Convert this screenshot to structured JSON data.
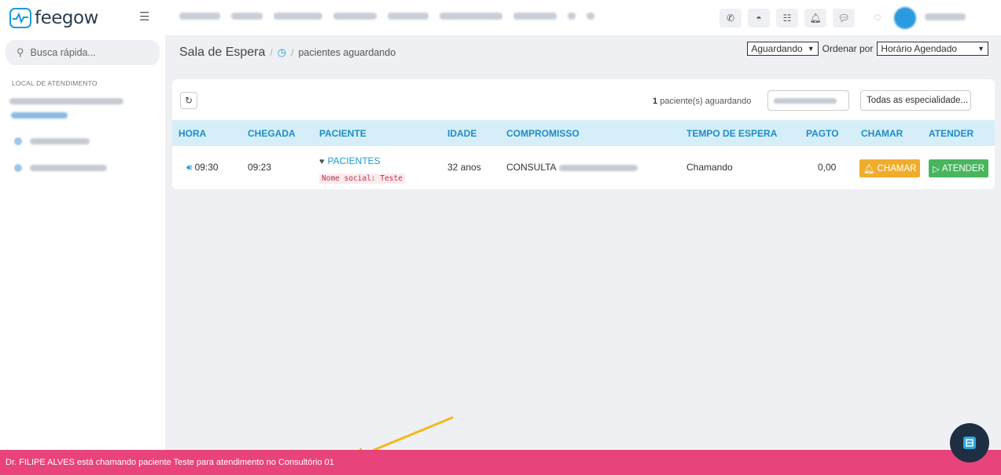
{
  "app": {
    "logo_text": "feegow"
  },
  "sidebar": {
    "search_placeholder": "Busca rápida...",
    "location_title": "LOCAL DE ATENDIMENTO"
  },
  "header": {
    "title": "Sala de Espera",
    "crumb": "pacientes aguardando",
    "status_filter": "Aguardando",
    "order_label": "Ordenar por",
    "order_value": "Horário Agendado"
  },
  "card": {
    "count_number": "1",
    "count_text": "paciente(s) aguardando",
    "specialty_select": "Todas as especialidade..."
  },
  "table": {
    "headers": [
      "HORA",
      "CHEGADA",
      "PACIENTE",
      "IDADE",
      "COMPROMISSO",
      "TEMPO DE ESPERA",
      "PAGTO",
      "CHAMAR",
      "ATENDER"
    ],
    "row": {
      "hora": "09:30",
      "chegada": "09:23",
      "paciente": "PACIENTES",
      "nome_social": "Nome social: Teste",
      "idade": "32 anos",
      "compromisso": "CONSULTA",
      "tempo_espera": "Chamando",
      "pagto": "0,00",
      "chamar": "CHAMAR",
      "atender": "ATENDER"
    }
  },
  "notification": {
    "text": "Dr. FILIPE ALVES está chamando paciente Teste para atendimento no Consultório 01"
  },
  "colors": {
    "brand": "#1b9cd8",
    "header_row": "#d6eef8",
    "chamar": "#f0ad2c",
    "atender": "#49b65e",
    "notification": "#e8437a",
    "annotation_arrow": "#f4b81c"
  },
  "icons": [
    "feegow-logo-icon",
    "menu-icon",
    "phone-icon",
    "inbox-icon",
    "list-icon",
    "bell-icon",
    "chat-icon",
    "search-icon",
    "clock-icon",
    "refresh-icon",
    "speaker-icon",
    "heart-icon",
    "bell-icon",
    "play-icon",
    "widget-icon"
  ]
}
